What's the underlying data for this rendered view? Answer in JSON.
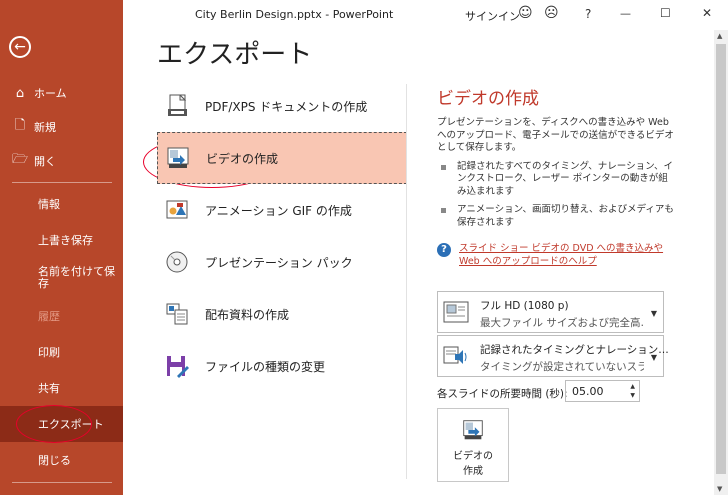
{
  "window": {
    "title": "City Berlin Design.pptx  -  PowerPoint",
    "signin": "サインイン",
    "smile": "☺",
    "frown": "☹",
    "help": "?",
    "minimize": "—",
    "maximize": "☐",
    "close": "✕"
  },
  "sidebar": {
    "back": "←",
    "top_items": [
      {
        "icon": "⌂",
        "label": "ホーム"
      },
      {
        "icon": "🗋",
        "label": "新規"
      },
      {
        "icon": "🗁",
        "label": "開く"
      }
    ],
    "sub_items": [
      {
        "label": "情報"
      },
      {
        "label": "上書き保存"
      },
      {
        "label": "名前を付けて保存"
      },
      {
        "label": "履歴"
      },
      {
        "label": "印刷"
      },
      {
        "label": "共有"
      },
      {
        "label": "エクスポート"
      },
      {
        "label": "閉じる"
      }
    ]
  },
  "main": {
    "title": "エクスポート",
    "items": [
      {
        "label": "PDF/XPS ドキュメントの作成"
      },
      {
        "label": "ビデオの作成"
      },
      {
        "label": "アニメーション GIF の作成"
      },
      {
        "label": "プレゼンテーション パック"
      },
      {
        "label": "配布資料の作成"
      },
      {
        "label": "ファイルの種類の変更"
      }
    ]
  },
  "detail": {
    "title": "ビデオの作成",
    "desc": "プレゼンテーションを、ディスクへの書き込みや Web へのアップロード、電子メールでの送信ができるビデオとして保存します。",
    "bullets": [
      "記録されたすべてのタイミング、ナレーション、インクストローク、レーザー ポインターの動きが組み込まれます",
      "アニメーション、画面切り替え、およびメディアも保存されます"
    ],
    "help_link": "スライド ショー ビデオの DVD への書き込みや Web へのアップロードのヘルプ",
    "quality": {
      "line1": "フル HD (1080 p)",
      "line2": "最大ファイル サイズおよび完全高…"
    },
    "timing": {
      "line1": "記録されたタイミングとナレーション…",
      "line2": "タイミングが設定されていないスライ…"
    },
    "duration_label": "各スライドの所要時間 (秒):",
    "duration_value": "05.00",
    "create_label_1": "ビデオの",
    "create_label_2": "作成"
  }
}
